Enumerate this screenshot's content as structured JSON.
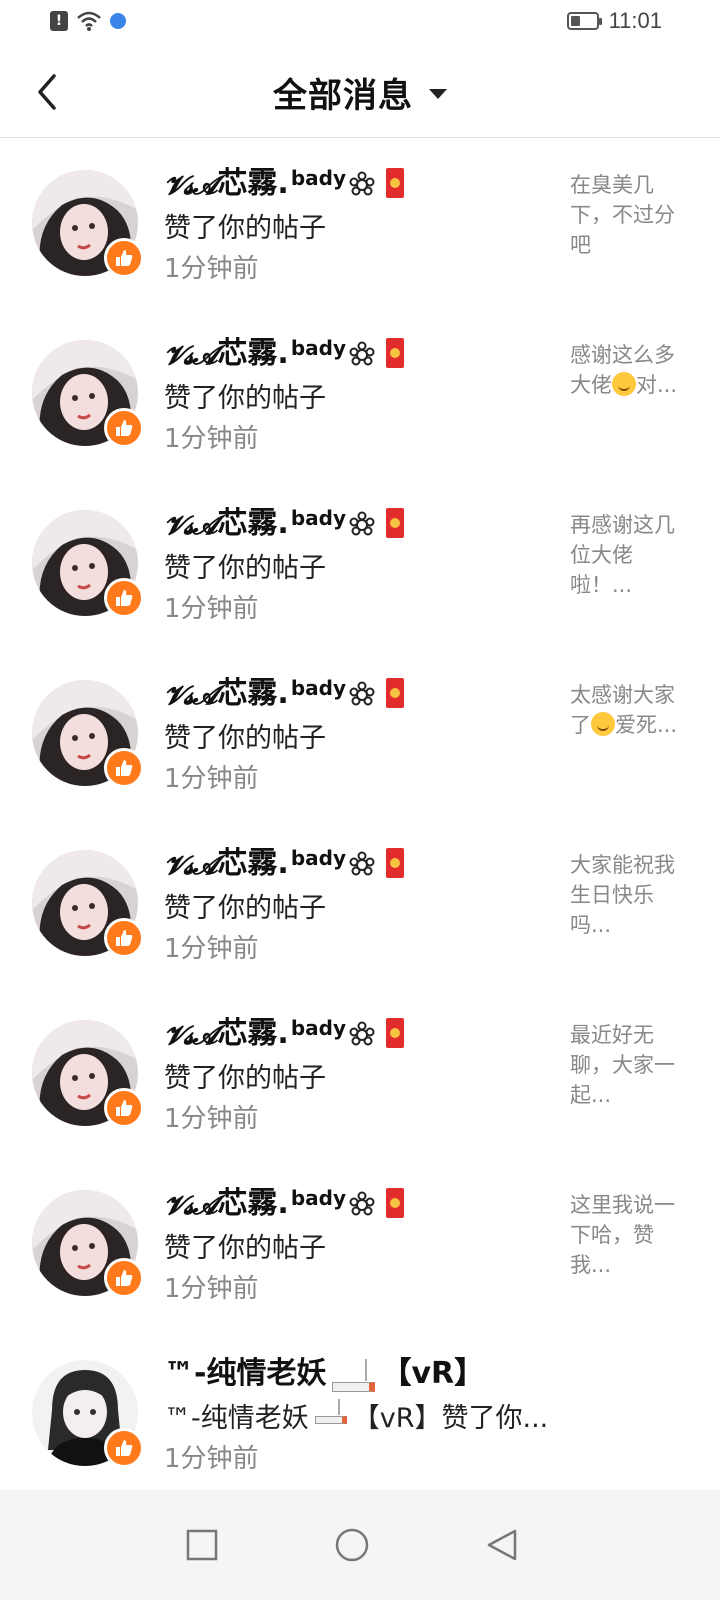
{
  "status_bar": {
    "time": "11:01",
    "battery_level": 0.35,
    "icons": [
      "alert-icon",
      "wifi-icon",
      "globe-icon",
      "battery-icon"
    ]
  },
  "header": {
    "title": "全部消息",
    "back_icon": "chevron-left-icon",
    "dropdown_icon": "caret-down-icon"
  },
  "messages": [
    {
      "name_prefix": "𝓥𝓼𝓐",
      "name": "芯霧.",
      "name_sup": "bady",
      "action": "赞了你的帖子",
      "time": "1分钟前",
      "preview": "在臭美几下，不过分吧"
    },
    {
      "name_prefix": "𝓥𝓼𝓐",
      "name": "芯霧.",
      "name_sup": "bady",
      "action": "赞了你的帖子",
      "time": "1分钟前",
      "preview_a": "感谢这么多大佬",
      "preview_b": "对..."
    },
    {
      "name_prefix": "𝓥𝓼𝓐",
      "name": "芯霧.",
      "name_sup": "bady",
      "action": "赞了你的帖子",
      "time": "1分钟前",
      "preview": "再感谢这几位大佬啦！..."
    },
    {
      "name_prefix": "𝓥𝓼𝓐",
      "name": "芯霧.",
      "name_sup": "bady",
      "action": "赞了你的帖子",
      "time": "1分钟前",
      "preview_a": "太感谢大家了",
      "preview_b": "爱死..."
    },
    {
      "name_prefix": "𝓥𝓼𝓐",
      "name": "芯霧.",
      "name_sup": "bady",
      "action": "赞了你的帖子",
      "time": "1分钟前",
      "preview": "大家能祝我生日快乐吗..."
    },
    {
      "name_prefix": "𝓥𝓼𝓐",
      "name": "芯霧.",
      "name_sup": "bady",
      "action": "赞了你的帖子",
      "time": "1分钟前",
      "preview": "最近好无聊，大家一起..."
    },
    {
      "name_prefix": "𝓥𝓼𝓐",
      "name": "芯霧.",
      "name_sup": "bady",
      "action": "赞了你的帖子",
      "time": "1分钟前",
      "preview": "这里我说一下哈，赞我..."
    }
  ],
  "last_message": {
    "name_a": "™-纯情老妖",
    "name_b": "【vR】",
    "action_a": "™-纯情老妖",
    "action_b": "【vR】赞了你...",
    "time": "1分钟前"
  },
  "nav_bar": {
    "icons": [
      "square-icon",
      "circle-icon",
      "triangle-back-icon"
    ]
  }
}
